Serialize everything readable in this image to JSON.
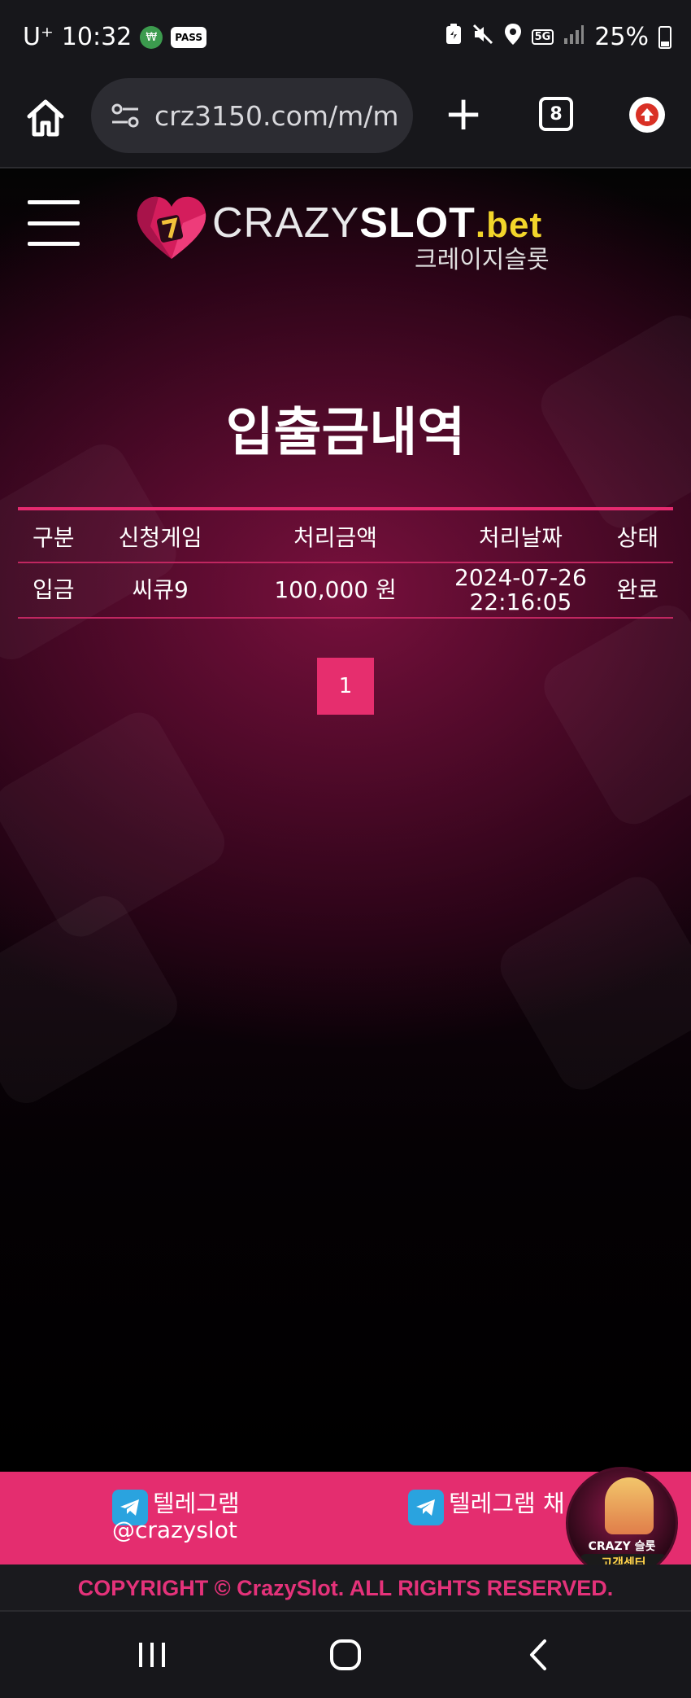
{
  "status_bar": {
    "carrier": "U⁺",
    "time": "10:32",
    "app_badge": "₩",
    "pass_badge": "PASS",
    "network": "5G",
    "battery": "25%"
  },
  "browser": {
    "url": "crz3150.com/m/m",
    "tab_count": "8"
  },
  "site": {
    "logo_crazy": "CRAZY",
    "logo_slot": "SLOT",
    "logo_bet": ".bet",
    "logo_korean": "크레이지슬롯"
  },
  "page": {
    "title": "입출금내역"
  },
  "table": {
    "headers": [
      "구분",
      "신청게임",
      "처리금액",
      "처리날짜",
      "상태"
    ],
    "rows": [
      {
        "type": "입금",
        "game": "씨큐9",
        "amount": "100,000 원",
        "date": "2024-07-26",
        "time": "22:16:05",
        "status": "완료"
      }
    ]
  },
  "pagination": {
    "current_page": "1"
  },
  "footer": {
    "telegram1_label": "텔레그램",
    "telegram1_handle": "@crazyslot",
    "telegram2_label": "텔레그램 채",
    "cs_brand": "CRAZY 슬롯",
    "cs_label": "고객센터",
    "copyright": "COPYRIGHT © CrazySlot. ALL RIGHTS RESERVED."
  },
  "colors": {
    "accent_pink": "#e42d6f",
    "logo_bet_yellow": "#f2d52a",
    "telegram_blue": "#2aa3df"
  }
}
